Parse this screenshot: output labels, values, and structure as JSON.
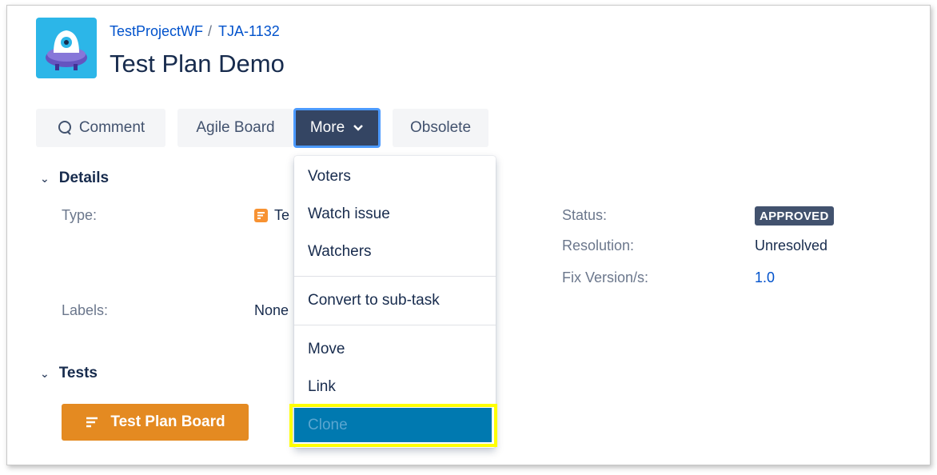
{
  "header": {
    "project": "TestProjectWF",
    "separator": "/",
    "issue_key": "TJA-1132",
    "title": "Test Plan Demo"
  },
  "toolbar": {
    "comment_label": "Comment",
    "agile_board_label": "Agile Board",
    "more_label": "More",
    "obsolete_label": "Obsolete"
  },
  "details": {
    "heading": "Details",
    "type_label": "Type:",
    "type_value": "Te",
    "labels_label": "Labels:",
    "labels_value": "None",
    "status_label": "Status:",
    "status_value": "APPROVED",
    "resolution_label": "Resolution:",
    "resolution_value": "Unresolved",
    "fix_version_label": "Fix Version/s:",
    "fix_version_value": "1.0"
  },
  "tests": {
    "heading": "Tests",
    "board_button": "Test Plan Board"
  },
  "more_menu": {
    "items": [
      "Voters",
      "Watch issue",
      "Watchers",
      "Convert to sub-task",
      "Move",
      "Link",
      "Clone"
    ]
  },
  "colors": {
    "accent_blue": "#0052cc",
    "more_button_bg": "#344563",
    "test_plan_board_bg": "#e48a21",
    "clone_highlight_bg": "#0079b0",
    "callout_border": "#ffff00",
    "status_badge_bg": "#42526e"
  }
}
